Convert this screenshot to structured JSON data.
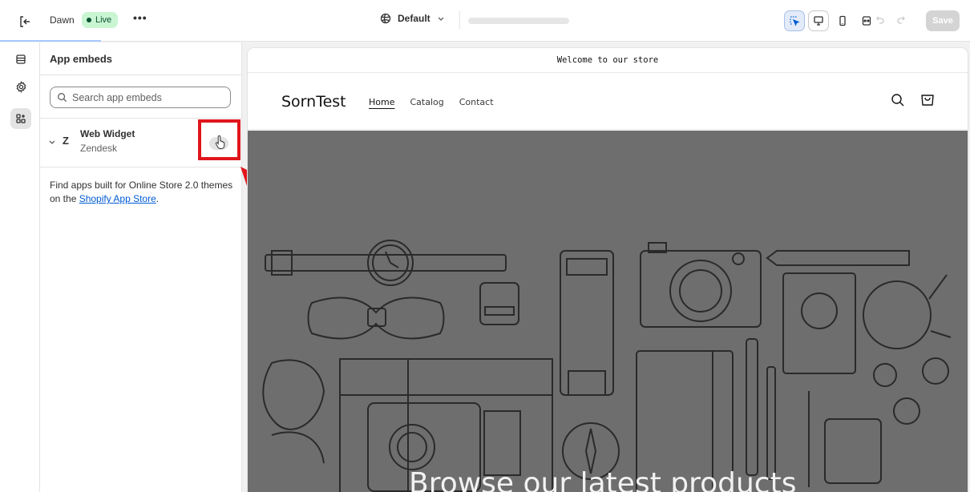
{
  "topbar": {
    "theme_name": "Dawn",
    "live_label": "Live",
    "more_label": "•••",
    "template_label": "Default",
    "save_label": "Save"
  },
  "panel": {
    "title": "App embeds",
    "search_placeholder": "Search app embeds",
    "embed": {
      "name": "Web Widget",
      "vendor": "Zendesk",
      "logo": "Z"
    },
    "help_text_before": "Find apps built for Online Store 2.0 themes on the ",
    "help_link": "Shopify App Store",
    "help_text_after": "."
  },
  "preview": {
    "announcement": "Welcome to our store",
    "store_name": "SornTest",
    "nav": [
      "Home",
      "Catalog",
      "Contact"
    ],
    "hero_title": "Browse our latest products"
  },
  "colors": {
    "highlight": "#e0161b",
    "live_bg": "#c9f5d3",
    "link": "#005bd3"
  }
}
